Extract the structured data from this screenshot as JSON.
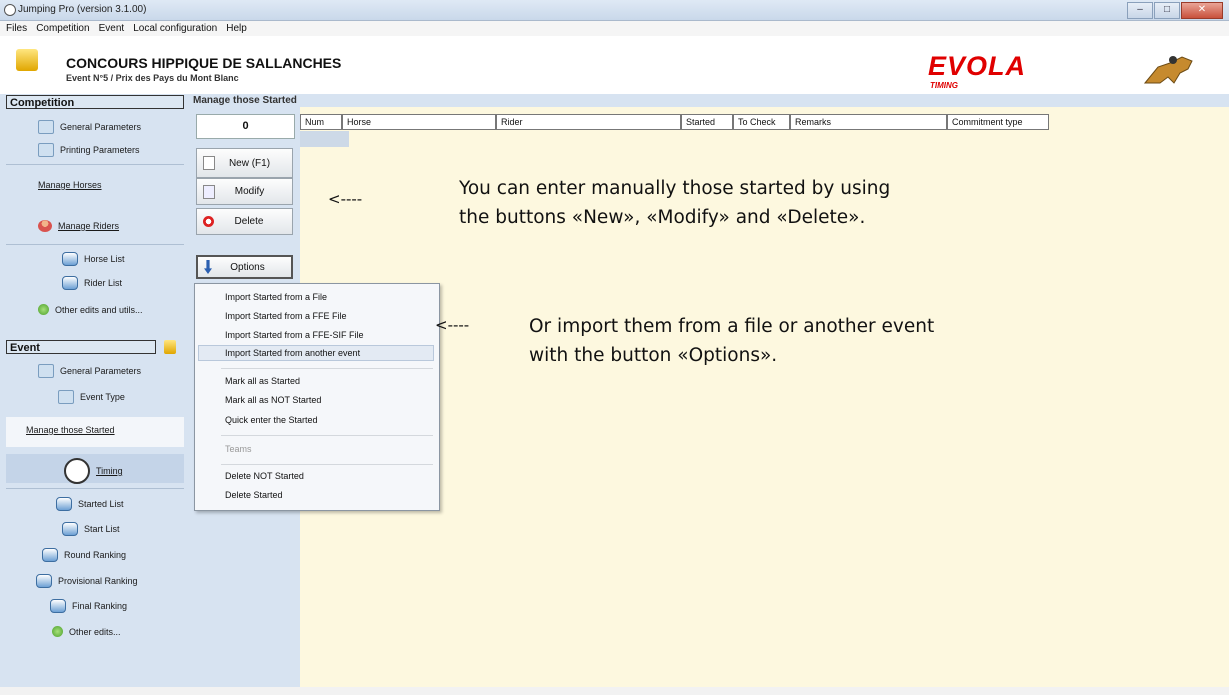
{
  "window": {
    "title": "Jumping Pro (version 3.1.00)"
  },
  "menubar": {
    "items": [
      "Files",
      "Competition",
      "Event",
      "Local configuration",
      "Help"
    ]
  },
  "header": {
    "title": "CONCOURS HIPPIQUE DE SALLANCHES",
    "subtitle": "Event N°5 / Prix des Pays du Mont Blanc",
    "logo_text": "EVOLA",
    "logo_sub": "TIMING"
  },
  "sidebar": {
    "competition_heading": "Competition",
    "competition_items": [
      "General Parameters",
      "Printing Parameters",
      "Manage Horses",
      "Manage Riders",
      "Horse List",
      "Rider List",
      "Other edits and utils..."
    ],
    "event_heading": "Event",
    "event_items": [
      "General Parameters",
      "Event Type",
      "Manage those Started",
      "Timing",
      "Started List",
      "Start List",
      "Round Ranking",
      "Provisional Ranking",
      "Final Ranking",
      "Other edits..."
    ]
  },
  "panel": {
    "title": "Manage those Started",
    "count": "0",
    "buttons": {
      "new": "New (F1)",
      "modify": "Modify",
      "delete": "Delete",
      "options": "Options"
    }
  },
  "table": {
    "columns": [
      "Num",
      "Horse",
      "Rider",
      "Started",
      "To Check",
      "Remarks",
      "Commitment type"
    ]
  },
  "options_menu": {
    "items": [
      "Import Started from a File",
      "Import Started from a FFE File",
      "Import Started from a FFE-SIF File",
      "Import Started from another event",
      "Mark all as Started",
      "Mark all as NOT Started",
      "Quick enter the Started",
      "Teams",
      "Delete NOT Started",
      "Delete Started"
    ],
    "selected": "Import Started from another event"
  },
  "annotations": {
    "arrow1": "<----",
    "text1_line1": "You can enter manually those started by using",
    "text1_line2": "the buttons «New», «Modify» and «Delete».",
    "arrow2": "<----",
    "text2_line1": "Or import them from a file or another event",
    "text2_line2": "with the button «Options»."
  }
}
